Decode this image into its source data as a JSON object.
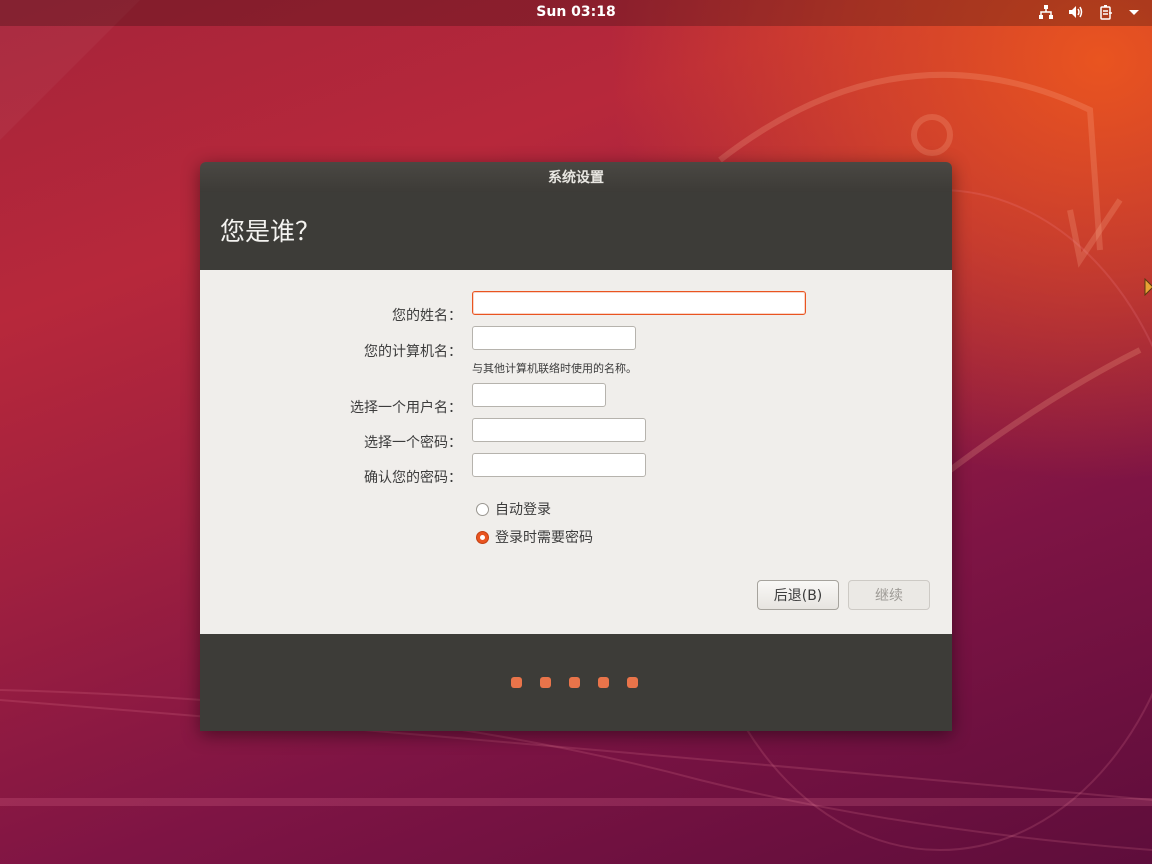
{
  "topbar": {
    "clock": "Sun 03:18",
    "tray_icons": [
      "network-icon",
      "volume-icon",
      "battery-icon",
      "system-menu-arrow-icon"
    ]
  },
  "window": {
    "title": "系统设置",
    "heading": "您是谁？",
    "form": {
      "name_label": "您的姓名：",
      "name_value": "",
      "computer_label": "您的计算机名：",
      "computer_value": "",
      "computer_hint": "与其他计算机联络时使用的名称。",
      "username_label": "选择一个用户名：",
      "username_value": "",
      "password_label": "选择一个密码：",
      "password_value": "",
      "confirm_label": "确认您的密码：",
      "confirm_value": ""
    },
    "login_options": [
      {
        "label": "自动登录",
        "checked": false
      },
      {
        "label": "登录时需要密码",
        "checked": true
      }
    ],
    "buttons": {
      "back": "后退(B)",
      "continue": "继续"
    },
    "progress": {
      "steps_total": 5
    }
  },
  "colors": {
    "accent": "#e95420",
    "dark_panel": "#3d3c38",
    "content_bg": "#f0eeeb"
  }
}
